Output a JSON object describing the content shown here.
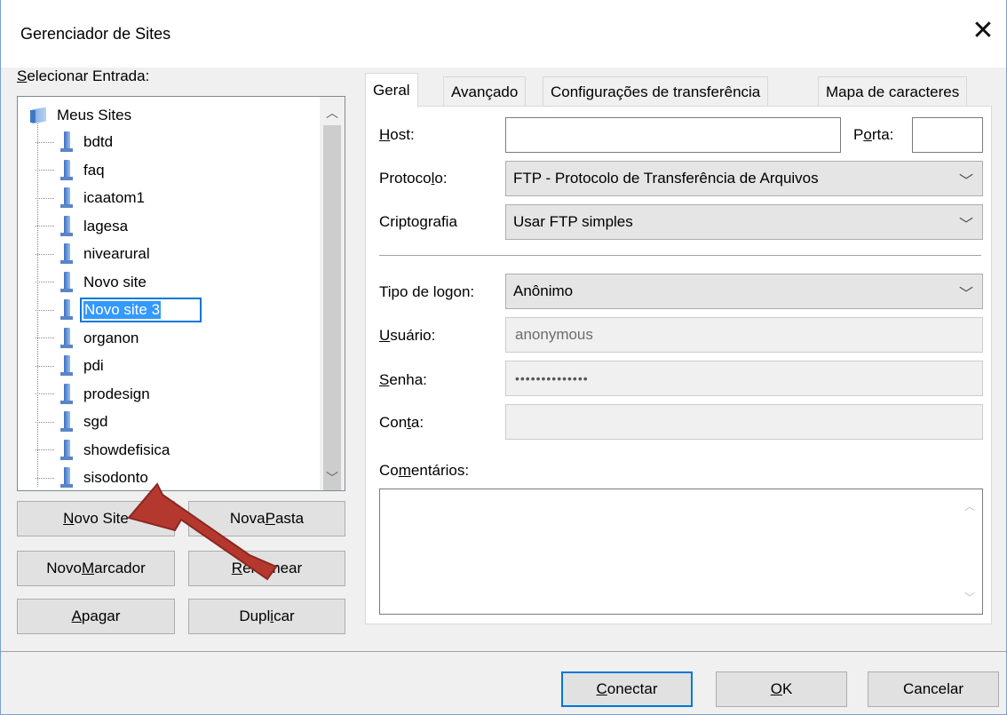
{
  "window": {
    "title": "Gerenciador de Sites",
    "close_glyph": "✕"
  },
  "left": {
    "select_label_first": "S",
    "select_label_rest": "elecionar Entrada:",
    "tree": {
      "root": "Meus Sites",
      "items": [
        "bdtd",
        "faq",
        "icaatom1",
        "lagesa",
        "nivearural",
        "Novo site",
        "Novo site 3",
        "organon",
        "pdi",
        "prodesign",
        "sgd",
        "showdefisica",
        "sisodonto"
      ],
      "editing_item": "Novo site 3"
    },
    "buttons": {
      "new_site": {
        "pre": "",
        "key": "N",
        "post": "ovo Site"
      },
      "new_folder": {
        "pre": "Nova ",
        "key": "P",
        "post": "asta"
      },
      "new_bookmark": {
        "pre": "Novo ",
        "key": "M",
        "post": "arcador"
      },
      "rename": {
        "pre": "",
        "key": "R",
        "post": "enomear"
      },
      "delete": {
        "pre": "",
        "key": "A",
        "post": "pagar"
      },
      "duplicate": {
        "pre": "Dupl",
        "key": "i",
        "post": "car"
      }
    }
  },
  "tabs": [
    "Geral",
    "Avançado",
    "Configurações de transferência",
    "Mapa de caracteres"
  ],
  "general": {
    "host": {
      "key": "H",
      "rest": "ost:",
      "value": ""
    },
    "port": {
      "pre": "P",
      "key": "o",
      "post": "rta:",
      "value": ""
    },
    "protocol": {
      "pre": "Protoco",
      "key": "l",
      "post": "o:",
      "value": "FTP - Protocolo de Transferência de Arquivos"
    },
    "encryption": {
      "pre": "Cripto",
      "key": "g",
      "post": "rafia",
      "value": "Usar FTP simples"
    },
    "logon_type": {
      "pre": "Tipo de lo",
      "key": "g",
      "post": "on:",
      "value": "Anônimo"
    },
    "user": {
      "pre": "",
      "key": "U",
      "post": "suário:",
      "value": "anonymous"
    },
    "password": {
      "pre": "",
      "key": "S",
      "post": "enha:",
      "value": "••••••••••••••"
    },
    "account": {
      "pre": "Con",
      "key": "t",
      "post": "a:",
      "value": ""
    },
    "comments": {
      "pre": "Co",
      "key": "m",
      "post": "entários:",
      "value": ""
    }
  },
  "footer": {
    "connect": {
      "pre": "",
      "key": "C",
      "post": "onectar"
    },
    "ok": {
      "pre": "",
      "key": "O",
      "post": "K"
    },
    "cancel": "Cancelar"
  },
  "colors": {
    "accent": "#0078d7",
    "arrow": "#b5382f",
    "selection": "#3399ff"
  }
}
